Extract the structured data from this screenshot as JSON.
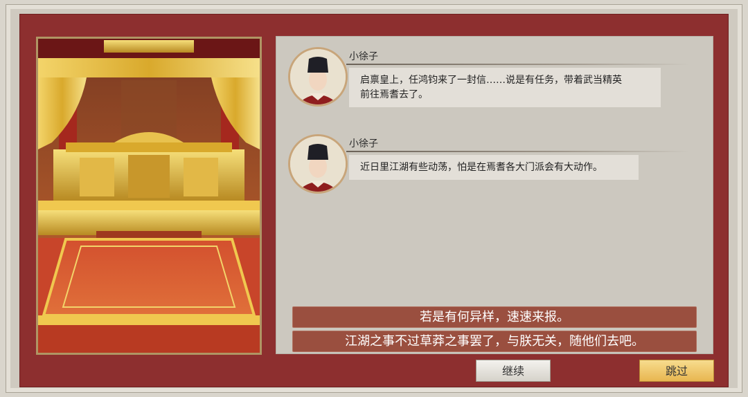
{
  "messages": [
    {
      "speaker": "小徐子",
      "lines": [
        "启禀皇上，任鸿钧来了一封信……说是有任务，带着武当精英",
        "前往焉耆去了。"
      ]
    },
    {
      "speaker": "小徐子",
      "lines": [
        "近日里江湖有些动荡，怕是在焉耆各大门派会有大动作。"
      ]
    }
  ],
  "choices": [
    "若是有何异样，速速来报。",
    "江湖之事不过草莽之事罢了，与朕无关，随他们去吧。"
  ],
  "buttons": {
    "continue_label": "继续",
    "skip_label": "跳过"
  },
  "colors": {
    "panel_red": "#8d2f2f",
    "choice_fill": "#9a4f3f",
    "skip_gold": "#e8b650"
  }
}
